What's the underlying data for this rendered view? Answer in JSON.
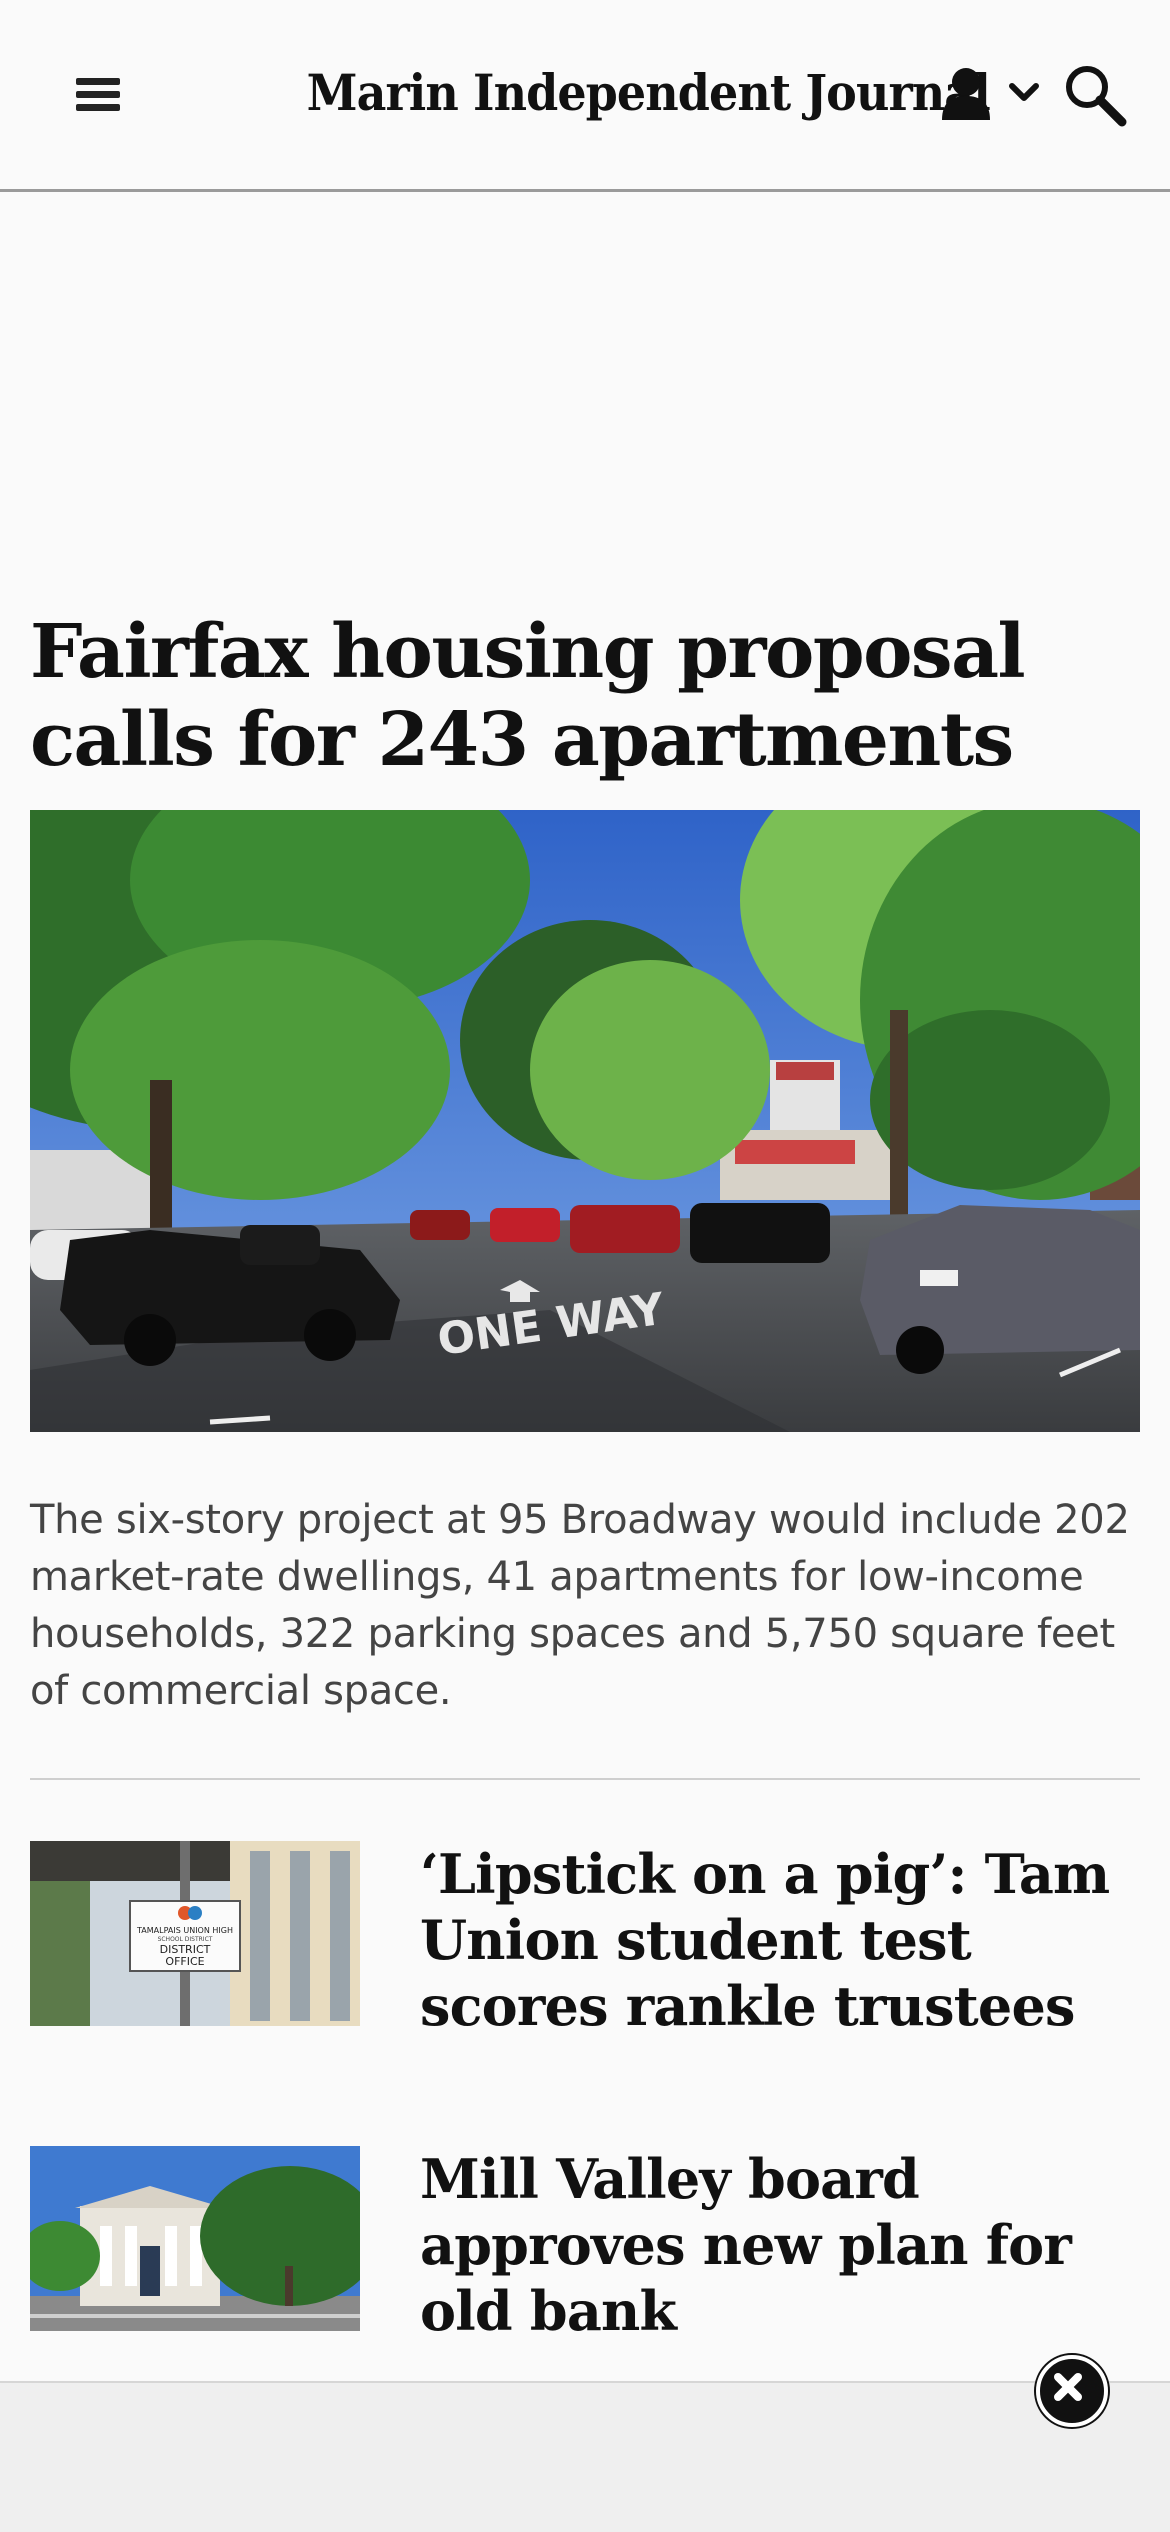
{
  "header": {
    "logo_text": "Marin Independent Journal",
    "menu_icon": "hamburger-menu-icon",
    "user_icon": "user-icon",
    "user_chevron_icon": "chevron-down-icon",
    "search_icon": "search-icon"
  },
  "article": {
    "headline": "Fairfax housing proposal calls for 243 apartments",
    "caption": "The six-story project at 95 Broadway would include 202 market-rate dwellings, 41 apartments for low-income households, 322 parking spaces and 5,750 square feet of commercial space.",
    "photo_road_text": "ONE WAY"
  },
  "related_stories": [
    {
      "title": "‘Lipstick on a pig’: Tam Union student test scores rankle trustees",
      "thumb_sign_lines": [
        "TAMALPAIS UNION HIGH",
        "SCHOOL DISTRICT",
        "DISTRICT",
        "OFFICE"
      ]
    },
    {
      "title": "Mill Valley board approves new plan for old bank"
    }
  ],
  "ad": {
    "close_icon": "close-icon"
  },
  "colors": {
    "background": "#fafafa",
    "text": "#111111",
    "caption_text": "#444444",
    "divider": "#cfcfcf",
    "ad_bar": "#efefef"
  }
}
